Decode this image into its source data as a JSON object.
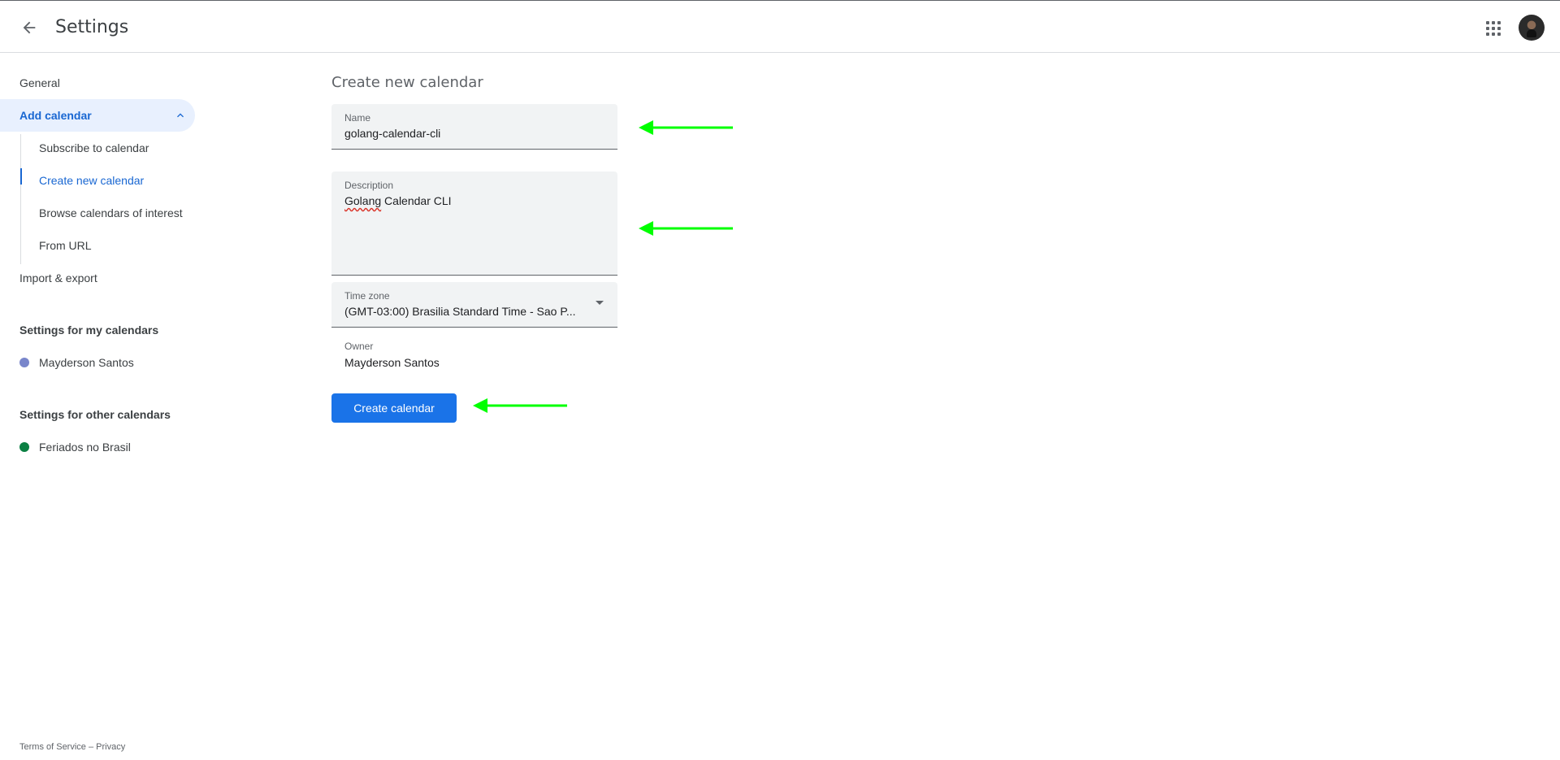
{
  "header": {
    "title": "Settings",
    "back_icon": "arrow-back-icon",
    "apps_icon": "apps-grid-icon"
  },
  "sidebar": {
    "general": "General",
    "add_calendar": "Add calendar",
    "sub_items": [
      {
        "label": "Subscribe to calendar"
      },
      {
        "label": "Create new calendar"
      },
      {
        "label": "Browse calendars of interest"
      },
      {
        "label": "From URL"
      }
    ],
    "import_export": "Import & export",
    "my_calendars_heading": "Settings for my calendars",
    "my_calendars": [
      {
        "label": "Mayderson Santos",
        "color": "#7986cb"
      }
    ],
    "other_calendars_heading": "Settings for other calendars",
    "other_calendars": [
      {
        "label": "Feriados no Brasil",
        "color": "#0b8043"
      }
    ]
  },
  "main": {
    "title": "Create new calendar",
    "name_label": "Name",
    "name_value": "golang-calendar-cli",
    "description_label": "Description",
    "description_value_spell": "Golang",
    "description_value_rest": " Calendar CLI",
    "timezone_label": "Time zone",
    "timezone_value": "(GMT-03:00) Brasilia Standard Time - Sao P...",
    "owner_label": "Owner",
    "owner_value": "Mayderson Santos",
    "create_button": "Create calendar"
  },
  "footer": {
    "terms": "Terms of Service",
    "separator": " – ",
    "privacy": "Privacy"
  },
  "colors": {
    "accent": "#1a73e8",
    "annotation_arrow": "#00ff00"
  }
}
